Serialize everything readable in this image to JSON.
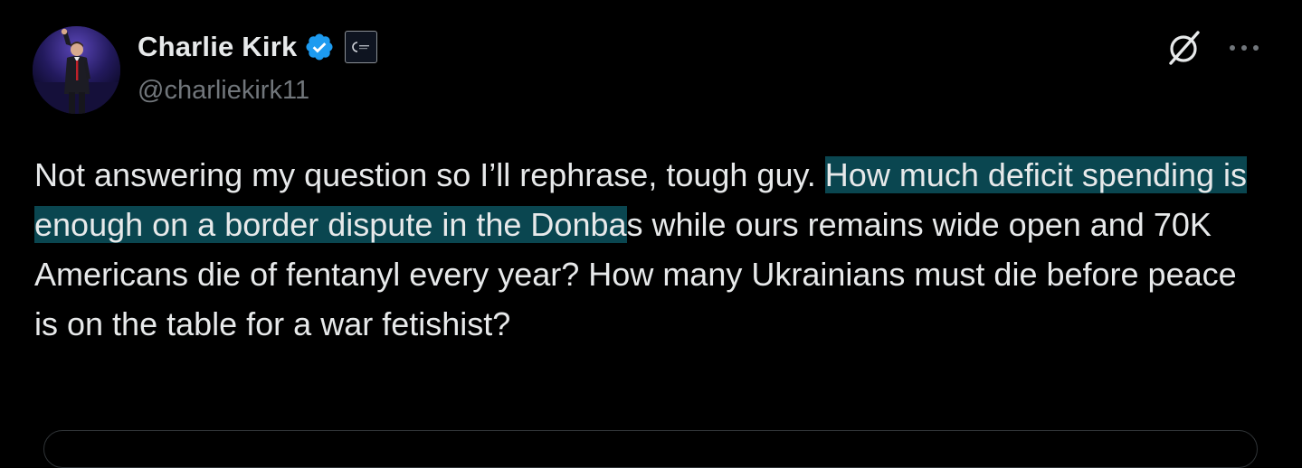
{
  "author": {
    "display_name": "Charlie Kirk",
    "handle": "@charliekirk11",
    "verified_color": "#1d9bf0",
    "verified_icon": "verified-badge-icon",
    "affiliate_icon": "organization-affiliate-badge"
  },
  "actions": {
    "grok_icon": "grok-slash-icon",
    "more_icon": "more-options-ellipsis-icon"
  },
  "tweet": {
    "text_part1": "Not answering my question so I’ll rephrase, tough guy. ",
    "text_highlight": "How much deficit spending is enough on a border dispute in the Donba",
    "text_part2": "s while ours remains wide open and 70K Americans die of fentanyl every year? How many Ukrainians must die before peace is on the table for a war fetishist?",
    "highlight_color": "#0a4650"
  },
  "theme": {
    "background": "#000000",
    "text": "#e7e9ea",
    "secondary_text": "#71767b"
  }
}
